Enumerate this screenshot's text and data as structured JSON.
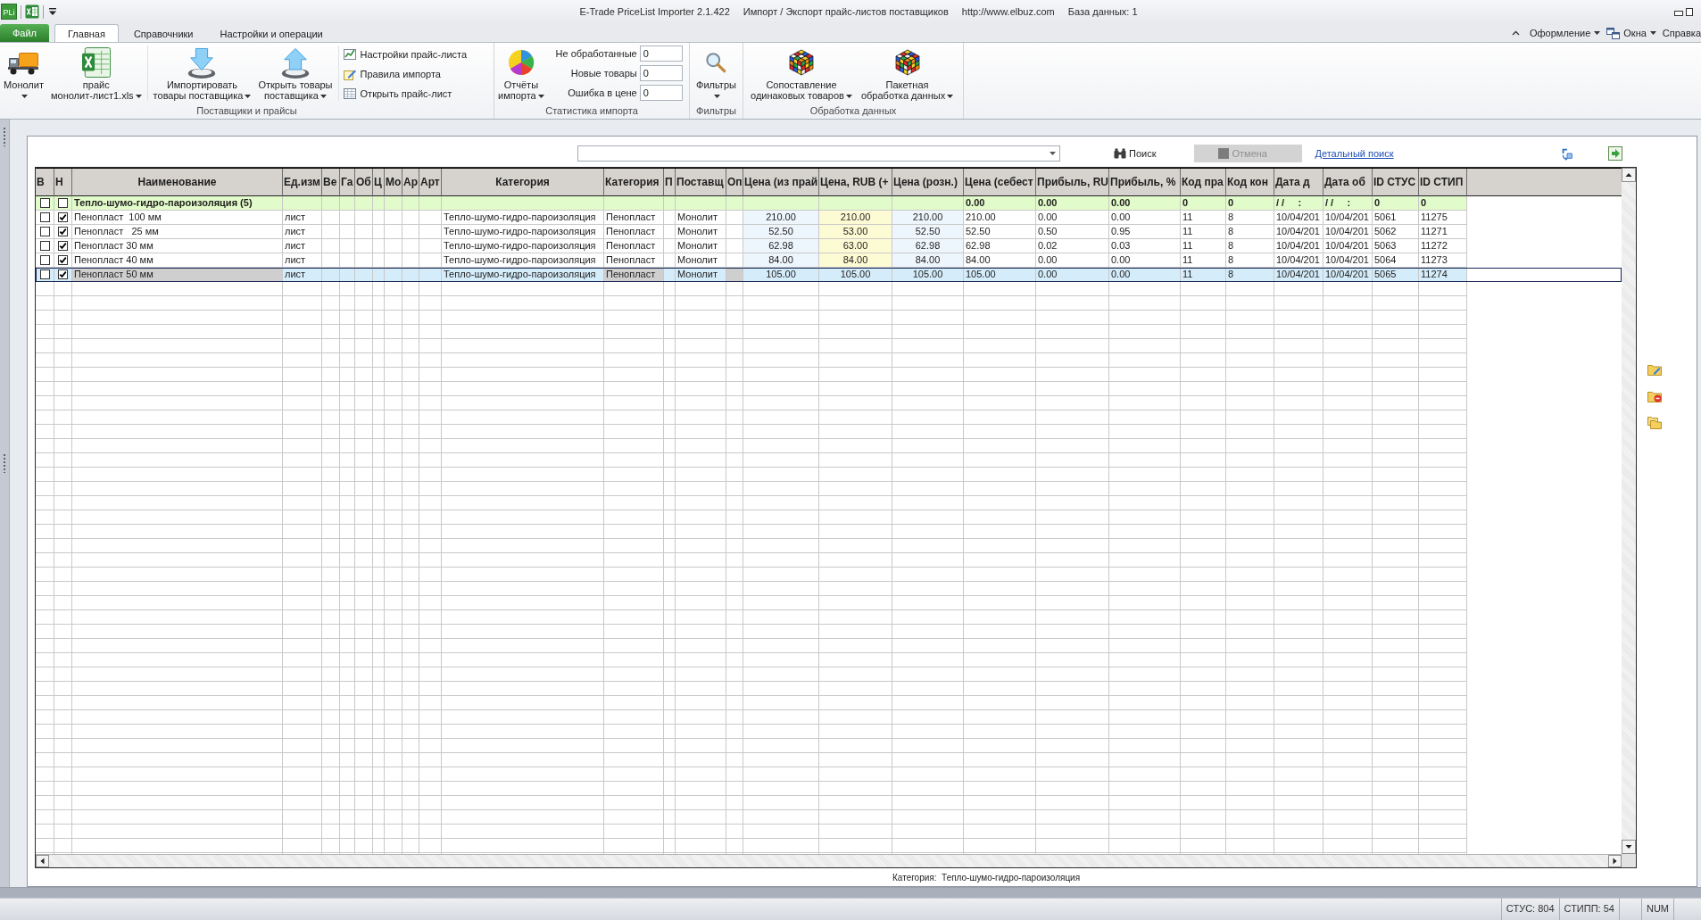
{
  "title_bar": {
    "app_badge": "PLi",
    "app_title": "E-Trade PriceList Importer 2.1.422",
    "subtitle": "Импорт / Экспорт прайс-листов поставщиков",
    "url": "http://www.elbuz.com",
    "database": "База данных: 1"
  },
  "menu": {
    "file_button": "Файл",
    "tabs": [
      {
        "label": "Главная",
        "selected": true
      },
      {
        "label": "Справочники",
        "selected": false
      },
      {
        "label": "Настройки и операции",
        "selected": false
      }
    ],
    "theme_menu": {
      "label": "Оформление",
      "dropdown": true
    },
    "windows_menu": {
      "label": "Окна",
      "dropdown": true
    },
    "help_menu": {
      "label": "Справка",
      "dropdown": false
    }
  },
  "ribbon": {
    "suppliers_group": {
      "label": "Поставщики и прайсы",
      "supplier_button": {
        "lines": [
          "Монолит"
        ],
        "dropdown": true
      },
      "pricelist_button": {
        "lines": [
          "прайс",
          "монолит-лист1.xls"
        ],
        "dropdown": true
      },
      "import_button": {
        "lines": [
          "Импортировать",
          "товары поставщика"
        ],
        "dropdown": true
      },
      "open_goods_button": {
        "lines": [
          "Открыть товары",
          "поставщика"
        ],
        "dropdown": true
      },
      "small_buttons": [
        "Настройки прайс-листа",
        "Правила импорта",
        "Открыть прайс-лист"
      ]
    },
    "stats_group": {
      "label": "Статистика импорта",
      "reports_button": {
        "lines": [
          "Отчёты",
          "импорта"
        ],
        "dropdown": true
      },
      "counters": [
        {
          "label": "Не обработанные",
          "value": "0"
        },
        {
          "label": "Новые товары",
          "value": "0"
        },
        {
          "label": "Ошибка в цене",
          "value": "0"
        }
      ]
    },
    "filters_group": {
      "label": "Фильтры",
      "filters_button": {
        "lines": [
          "Фильтры"
        ],
        "dropdown": true
      }
    },
    "processing_group": {
      "label": "Обработка данных",
      "match_button": {
        "lines": [
          "Сопоставление",
          "одинаковых товаров"
        ],
        "dropdown": true
      },
      "batch_button": {
        "lines": [
          "Пакетная",
          "обработка данных"
        ],
        "dropdown": true
      }
    }
  },
  "search_bar": {
    "search_button": "Поиск",
    "cancel_button": {
      "label": "Отмена",
      "disabled": true
    },
    "detailed_search_link": "Детальный поиск"
  },
  "grid": {
    "columns": [
      "В",
      "Н",
      "Наименование",
      "Ед.изм",
      "Ве",
      "Га",
      "Об",
      "Ц",
      "Мо",
      "Ар",
      "Арт",
      "Категория",
      "Категория",
      "П",
      "Поставщ",
      "Оп",
      "Цена (из прай",
      "Цена, RUB (+",
      "Цена (розн.)",
      "Цена (себест",
      "Прибыль, RU",
      "Прибыль, %",
      "Код пра",
      "Код кон",
      "Дата д",
      "Дата об",
      "ID СТУС",
      "ID СТИП"
    ],
    "rows": [
      {
        "kind": "group",
        "label": "Тепло-шумо-гидро-пароизоляция (5)",
        "b_checked": false,
        "h_checked": false,
        "selected": false,
        "price_cost": "0.00",
        "profit_rub": "0.00",
        "profit_pct": "0.00",
        "code_1": "0",
        "code_2": "0",
        "date_1": "/ /     :",
        "date_2": "/ /     :",
        "id_stus": "0",
        "id_stip": "0"
      },
      {
        "kind": "item",
        "b_checked": false,
        "h_checked": true,
        "selected": false,
        "name": "Пенопласт  100 мм",
        "unit": "лист",
        "category": "Тепло-шумо-гидро-пароизоляция",
        "category_2": "Пенопласт",
        "supplier": "Монолит",
        "price_list": "210.00",
        "price_rub": "210.00",
        "price_retail": "210.00",
        "price_cost": "210.00",
        "profit_rub": "0.00",
        "profit_pct": "0.00",
        "code_1": "11",
        "code_2": "8",
        "date_1": "10/04/201",
        "date_2": "10/04/201",
        "id_stus": "5061",
        "id_stip": "11275"
      },
      {
        "kind": "item",
        "b_checked": false,
        "h_checked": true,
        "selected": false,
        "name": "Пенопласт   25 мм",
        "unit": "лист",
        "category": "Тепло-шумо-гидро-пароизоляция",
        "category_2": "Пенопласт",
        "supplier": "Монолит",
        "price_list": "52.50",
        "price_rub": "53.00",
        "price_retail": "52.50",
        "price_cost": "52.50",
        "profit_rub": "0.50",
        "profit_pct": "0.95",
        "code_1": "11",
        "code_2": "8",
        "date_1": "10/04/201",
        "date_2": "10/04/201",
        "id_stus": "5062",
        "id_stip": "11271"
      },
      {
        "kind": "item",
        "b_checked": false,
        "h_checked": true,
        "selected": false,
        "name": "Пенопласт 30 мм",
        "unit": "лист",
        "category": "Тепло-шумо-гидро-пароизоляция",
        "category_2": "Пенопласт",
        "supplier": "Монолит",
        "price_list": "62.98",
        "price_rub": "63.00",
        "price_retail": "62.98",
        "price_cost": "62.98",
        "profit_rub": "0.02",
        "profit_pct": "0.03",
        "code_1": "11",
        "code_2": "8",
        "date_1": "10/04/201",
        "date_2": "10/04/201",
        "id_stus": "5063",
        "id_stip": "11272"
      },
      {
        "kind": "item",
        "b_checked": false,
        "h_checked": true,
        "selected": false,
        "name": "Пенопласт 40 мм",
        "unit": "лист",
        "category": "Тепло-шумо-гидро-пароизоляция",
        "category_2": "Пенопласт",
        "supplier": "Монолит",
        "price_list": "84.00",
        "price_rub": "84.00",
        "price_retail": "84.00",
        "price_cost": "84.00",
        "profit_rub": "0.00",
        "profit_pct": "0.00",
        "code_1": "11",
        "code_2": "8",
        "date_1": "10/04/201",
        "date_2": "10/04/201",
        "id_stus": "5064",
        "id_stip": "11273"
      },
      {
        "kind": "item",
        "b_checked": false,
        "h_checked": true,
        "selected": true,
        "name": "Пенопласт 50 мм",
        "unit": "лист",
        "category": "Тепло-шумо-гидро-пароизоляция",
        "category_2": "Пенопласт",
        "supplier": "Монолит",
        "price_list": "105.00",
        "price_rub": "105.00",
        "price_retail": "105.00",
        "price_cost": "105.00",
        "profit_rub": "0.00",
        "profit_pct": "0.00",
        "code_1": "11",
        "code_2": "8",
        "date_1": "10/04/201",
        "date_2": "10/04/201",
        "id_stus": "5065",
        "id_stip": "11274"
      }
    ]
  },
  "footer_caption": "Категория:  Тепло-шумо-гидро-пароизоляция",
  "status_bar": {
    "panels": [
      "СТУС: 804",
      "СТИПП: 54",
      "NUM"
    ]
  }
}
